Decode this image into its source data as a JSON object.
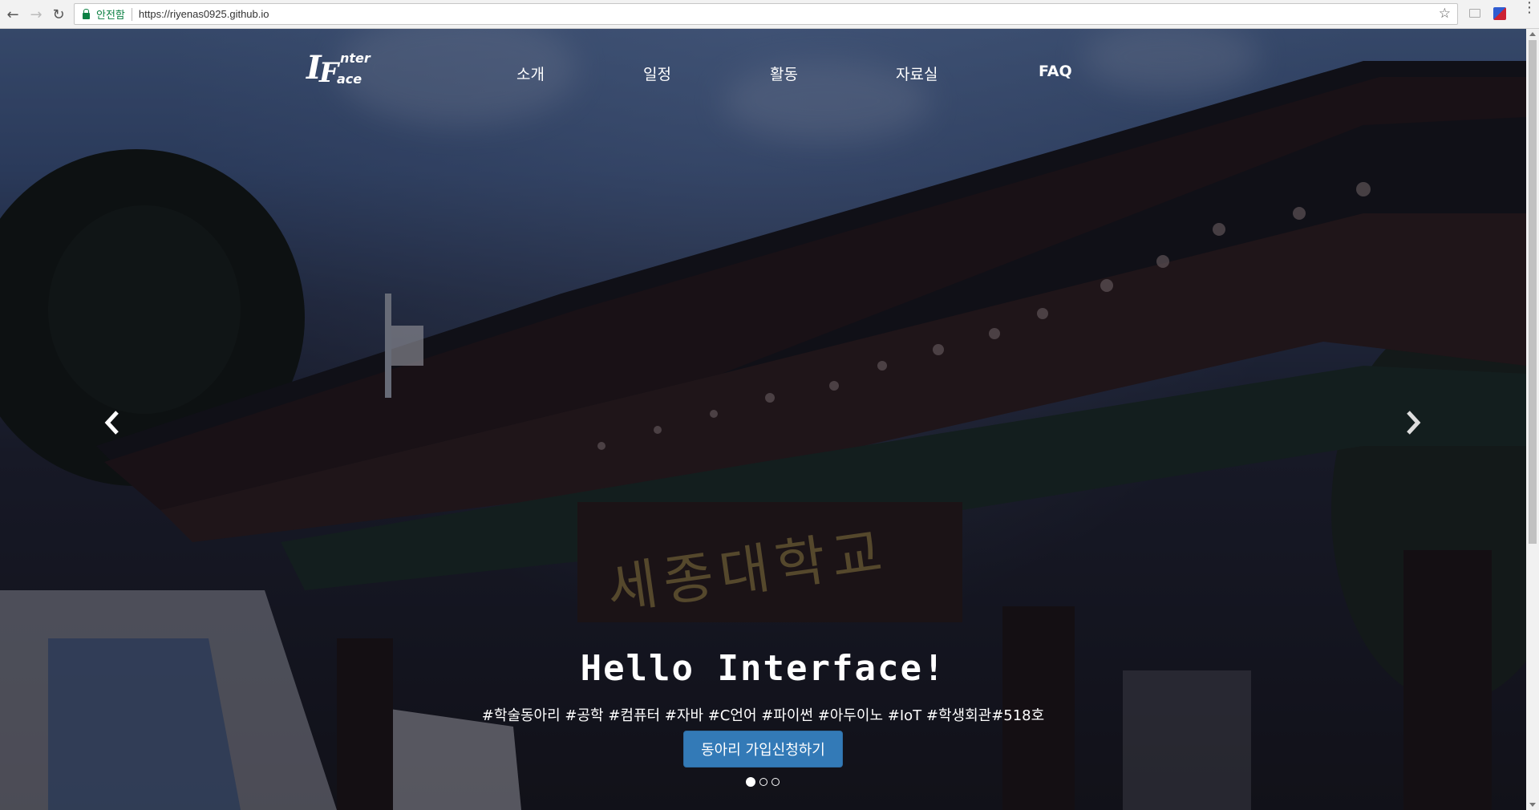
{
  "browser": {
    "secure_label": "안전함",
    "url": "https://riyenas0925.github.io"
  },
  "site": {
    "logo_alt": "Interface logo",
    "nav": [
      {
        "label": "소개"
      },
      {
        "label": "일정"
      },
      {
        "label": "활동"
      },
      {
        "label": "자료실"
      },
      {
        "label": "FAQ"
      }
    ]
  },
  "carousel": {
    "background_sign_text": "세종대학교",
    "caption_title": "Hello Interface!",
    "caption_tags": "#학술동아리 #공학 #컴퓨터 #자바 #C언어 #파이썬 #아두이노 #IoT #학생회관#518호",
    "join_button": "동아리 가입신청하기",
    "slide_count": 3,
    "active_slide": 1
  },
  "icons": [
    "back-icon",
    "forward-icon",
    "reload-icon",
    "lock-icon",
    "star-icon",
    "extension-icon",
    "menu-icon",
    "chevron-left-icon",
    "chevron-right-icon"
  ],
  "colors": {
    "primary_button": "#337ab7",
    "secure_green": "#0b8043"
  }
}
